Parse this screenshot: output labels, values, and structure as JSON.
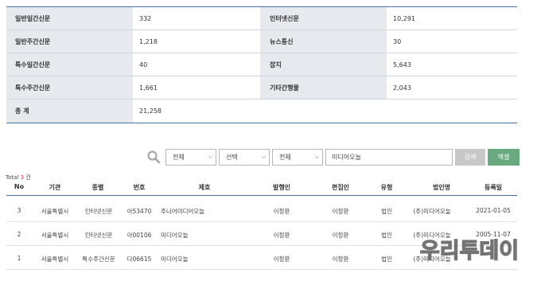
{
  "stats": {
    "rows": [
      {
        "label1": "일반일간신문",
        "value1": "332",
        "label2": "인터넷신문",
        "value2": "10,291"
      },
      {
        "label1": "일반주간신문",
        "value1": "1,218",
        "label2": "뉴스통신",
        "value2": "30"
      },
      {
        "label1": "특수일간신문",
        "value1": "40",
        "label2": "잡지",
        "value2": "5,643"
      },
      {
        "label1": "특수주간신문",
        "value1": "1,661",
        "label2": "기타간행물",
        "value2": "2,043"
      }
    ],
    "total_label": "총 계",
    "total_value": "21,258"
  },
  "search": {
    "select1": "전체",
    "select2": "선택",
    "select3": "전체",
    "keyword": "미디어오늘",
    "search_label": "검색",
    "excel_label": "엑셀"
  },
  "results": {
    "total_prefix": "Total",
    "total_count": "3",
    "total_suffix": "건",
    "headers": [
      "No",
      "기관",
      "종별",
      "번호",
      "제호",
      "발행인",
      "편집인",
      "유형",
      "법인명",
      "등록일"
    ],
    "rows": [
      [
        "3",
        "서울특별시",
        "인터넷신문",
        "아53470",
        "주니어미디어오늘",
        "이정환",
        "이정환",
        "법인",
        "(주)미디어오늘",
        "2021-01-05"
      ],
      [
        "2",
        "서울특별시",
        "인터넷신문",
        "아00106",
        "미디어오늘",
        "이정환",
        "이정환",
        "법인",
        "(주)미디어오늘",
        "2005-11-07"
      ],
      [
        "1",
        "서울특별시",
        "특수주간신문",
        "다06615",
        "미디어오늘",
        "이정환",
        "이정환",
        "법인",
        "(주)미디어오늘",
        ""
      ]
    ]
  },
  "watermark": {
    "text": "우리투데이"
  },
  "colors": {
    "accent": "#4a6fa0",
    "label_bg": "#e6eaee",
    "excel": "#69a97f",
    "count": "#dd3333"
  }
}
